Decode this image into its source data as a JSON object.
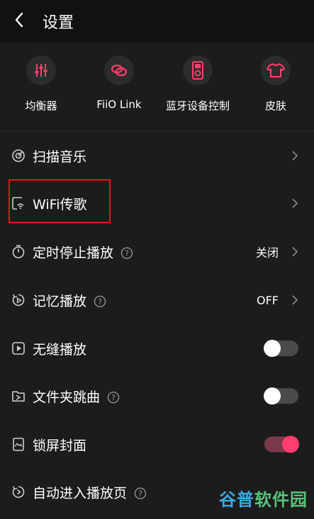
{
  "header": {
    "title": "设置"
  },
  "shortcuts": [
    {
      "label": "均衡器",
      "icon": "equalizer-icon"
    },
    {
      "label": "FiiO Link",
      "icon": "link-icon"
    },
    {
      "label": "蓝牙设备控制",
      "icon": "bluetooth-device-icon"
    },
    {
      "label": "皮肤",
      "icon": "skin-shirt-icon"
    }
  ],
  "rows": [
    {
      "label": "扫描音乐",
      "icon": "scan-icon",
      "control": "chevron"
    },
    {
      "label": "WiFi传歌",
      "icon": "wifi-transfer-icon",
      "control": "chevron"
    },
    {
      "label": "定时停止播放",
      "icon": "timer-icon",
      "control": "chevron",
      "value": "关闭",
      "help": true
    },
    {
      "label": "记忆播放",
      "icon": "memory-play-icon",
      "control": "chevron",
      "value": "OFF",
      "help": true
    },
    {
      "label": "无缝播放",
      "icon": "gapless-play-icon",
      "control": "toggle",
      "state": "off"
    },
    {
      "label": "文件夹跳曲",
      "icon": "folder-skip-icon",
      "control": "toggle",
      "state": "off",
      "help": true
    },
    {
      "label": "锁屏封面",
      "icon": "lockscreen-cover-icon",
      "control": "toggle",
      "state": "on"
    },
    {
      "label": "自动进入播放页",
      "icon": "auto-play-page-icon",
      "control": "toggle",
      "state": "off",
      "help": true
    }
  ],
  "colors": {
    "accent": "#ff3d6e",
    "background": "#1c1c1c",
    "header": "#111111",
    "highlight": "#e01717"
  },
  "watermark": {
    "part1": "谷普",
    "part2": "软件园"
  }
}
